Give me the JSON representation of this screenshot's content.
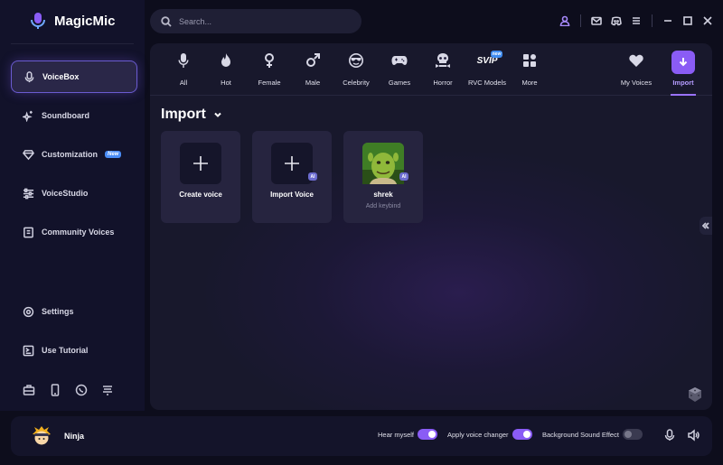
{
  "app": {
    "name": "MagicMic"
  },
  "search": {
    "placeholder": "Search..."
  },
  "sidebar": {
    "items": [
      {
        "label": "VoiceBox",
        "icon": "microphone-icon",
        "active": true
      },
      {
        "label": "Soundboard",
        "icon": "sparkle-icon"
      },
      {
        "label": "Customization",
        "icon": "diamond-icon",
        "badge": "New"
      },
      {
        "label": "VoiceStudio",
        "icon": "sliders-icon"
      },
      {
        "label": "Community Voices",
        "icon": "folder-icon"
      }
    ],
    "bottom_items": [
      {
        "label": "Settings",
        "icon": "gear-icon"
      },
      {
        "label": "Use Tutorial",
        "icon": "tutorial-icon"
      }
    ]
  },
  "categories": [
    {
      "label": "All",
      "icon": "microphone-icon"
    },
    {
      "label": "Hot",
      "icon": "flame-icon"
    },
    {
      "label": "Female",
      "icon": "female-icon"
    },
    {
      "label": "Male",
      "icon": "male-icon"
    },
    {
      "label": "Celebrity",
      "icon": "sunglasses-icon"
    },
    {
      "label": "Games",
      "icon": "gamepad-icon"
    },
    {
      "label": "Horror",
      "icon": "skull-icon"
    },
    {
      "label": "RVC Models",
      "icon": "svip-icon",
      "icon_text": "SVIP",
      "badge": "new"
    },
    {
      "label": "More",
      "icon": "grid-icon"
    },
    {
      "label": "My Voices",
      "icon": "heart-icon"
    },
    {
      "label": "Import",
      "icon": "download-icon",
      "active": true
    }
  ],
  "section": {
    "title": "Import"
  },
  "cards": [
    {
      "name": "Create voice",
      "sub": ""
    },
    {
      "name": "Import Voice",
      "sub": "",
      "badge": "AI"
    },
    {
      "name": "shrek",
      "sub": "Add keybind",
      "badge": "AI"
    }
  ],
  "footer": {
    "username": "Ninja",
    "hear_myself": {
      "label": "Hear myself",
      "on": true
    },
    "apply_changer": {
      "label": "Apply voice changer",
      "on": true
    },
    "background_effect": {
      "label": "Background Sound Effect",
      "on": false
    }
  },
  "colors": {
    "accent": "#8a5cf5",
    "active_tab": "#b59cff",
    "badge": "#4a8cf5"
  }
}
